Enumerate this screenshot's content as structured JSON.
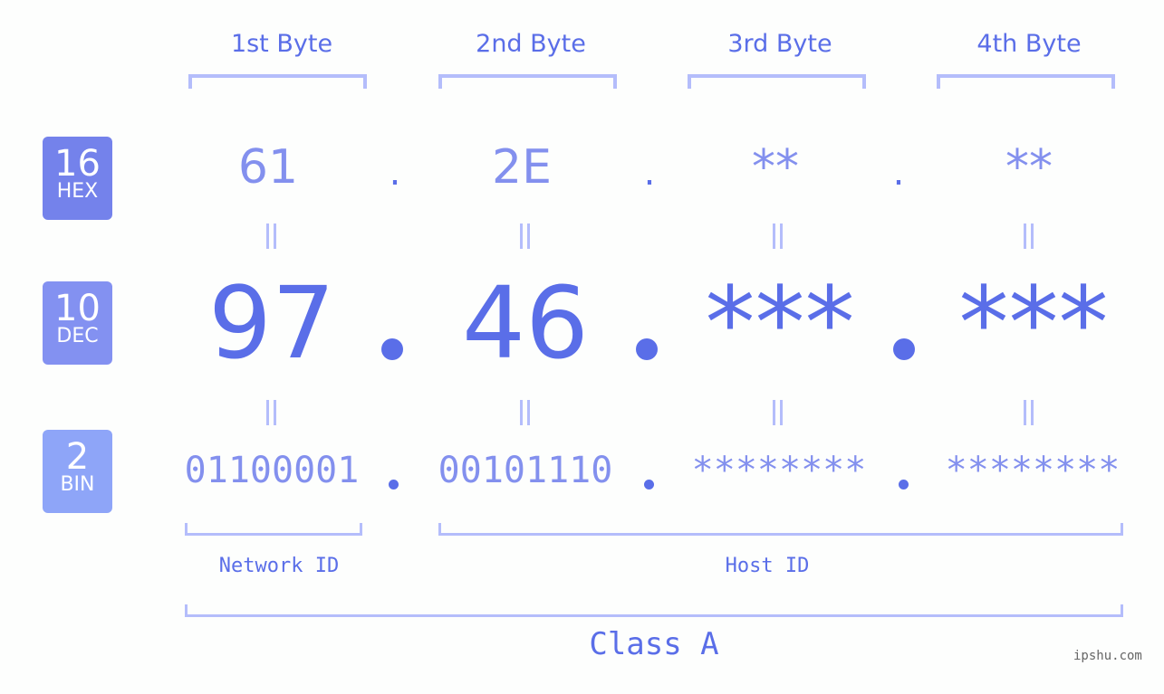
{
  "colors": {
    "accent": "#5a6ee8",
    "light": "#8390ee",
    "bracket": "#b4bdfb",
    "hex_badge": "#7482eb",
    "dec_badge": "#8391f1",
    "bin_badge": "#8ea5f8"
  },
  "bytes": {
    "headers": [
      "1st Byte",
      "2nd Byte",
      "3rd Byte",
      "4th Byte"
    ]
  },
  "rows": {
    "hex": {
      "base": "16",
      "label": "HEX",
      "values": [
        "61",
        "2E",
        "**",
        "**"
      ]
    },
    "dec": {
      "base": "10",
      "label": "DEC",
      "values": [
        "97",
        "46",
        "***",
        "***"
      ]
    },
    "bin": {
      "base": "2",
      "label": "BIN",
      "values": [
        "01100001",
        "00101110",
        "********",
        "********"
      ]
    }
  },
  "separator": ".",
  "parts": {
    "network": "Network ID",
    "host": "Host ID"
  },
  "class_label": "Class A",
  "watermark": "ipshu.com"
}
